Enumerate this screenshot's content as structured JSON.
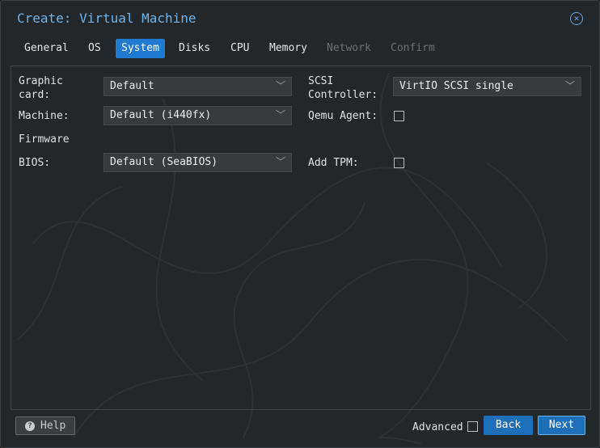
{
  "dialog": {
    "title": "Create: Virtual Machine",
    "close_icon": "close-icon"
  },
  "tabs": [
    {
      "label": "General",
      "state": "normal"
    },
    {
      "label": "OS",
      "state": "normal"
    },
    {
      "label": "System",
      "state": "active"
    },
    {
      "label": "Disks",
      "state": "normal"
    },
    {
      "label": "CPU",
      "state": "normal"
    },
    {
      "label": "Memory",
      "state": "normal"
    },
    {
      "label": "Network",
      "state": "disabled"
    },
    {
      "label": "Confirm",
      "state": "disabled"
    }
  ],
  "form": {
    "graphic_card": {
      "label_line1": "Graphic",
      "label_line2": "card:",
      "value": "Default"
    },
    "machine": {
      "label": "Machine:",
      "value": "Default (i440fx)"
    },
    "firmware_header": "Firmware",
    "bios": {
      "label": "BIOS:",
      "value": "Default (SeaBIOS)"
    },
    "scsi_controller": {
      "label_line1": "SCSI",
      "label_line2": "Controller:",
      "value": "VirtIO SCSI single"
    },
    "qemu_agent": {
      "label": "Qemu Agent:",
      "checked": false
    },
    "add_tpm": {
      "label": "Add TPM:",
      "checked": false
    }
  },
  "footer": {
    "help_label": "Help",
    "help_icon": "question-circle-icon",
    "advanced_label": "Advanced",
    "advanced_checked": false,
    "back_label": "Back",
    "next_label": "Next"
  },
  "colors": {
    "accent": "#1f7ad1",
    "title": "#6fb3ea",
    "background": "#23272a"
  }
}
